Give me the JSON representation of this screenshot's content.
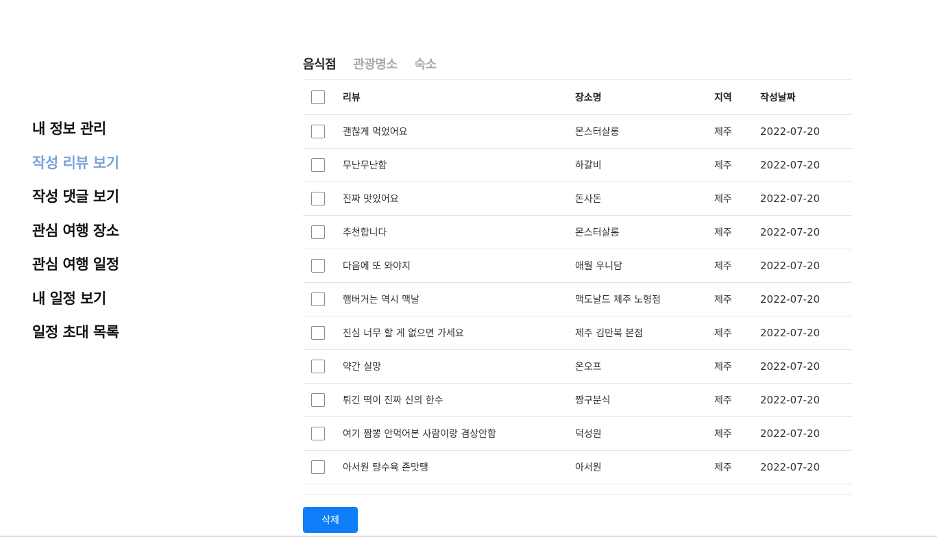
{
  "sidebar": {
    "items": [
      {
        "label": "내 정보 관리",
        "active": false
      },
      {
        "label": "작성 리뷰 보기",
        "active": true
      },
      {
        "label": "작성 댓글 보기",
        "active": false
      },
      {
        "label": "관심 여행 장소",
        "active": false
      },
      {
        "label": "관심 여행 일정",
        "active": false
      },
      {
        "label": "내 일정 보기",
        "active": false
      },
      {
        "label": "일정 초대 목록",
        "active": false
      }
    ]
  },
  "tabs": [
    {
      "label": "음식점",
      "active": true
    },
    {
      "label": "관광명소",
      "active": false
    },
    {
      "label": "숙소",
      "active": false
    }
  ],
  "table": {
    "headers": {
      "review": "리뷰",
      "place": "장소명",
      "region": "지역",
      "date": "작성날짜"
    },
    "rows": [
      {
        "review": "괜찮게 먹었어요",
        "place": "몬스터살롱",
        "region": "제주",
        "date": "2022-07-20"
      },
      {
        "review": "무난무난함",
        "place": "하갈비",
        "region": "제주",
        "date": "2022-07-20"
      },
      {
        "review": "진짜 맛있어요",
        "place": "돈사돈",
        "region": "제주",
        "date": "2022-07-20"
      },
      {
        "review": "추천합니다",
        "place": "몬스터살롱",
        "region": "제주",
        "date": "2022-07-20"
      },
      {
        "review": "다음에 또 와야지",
        "place": "애월 우니담",
        "region": "제주",
        "date": "2022-07-20"
      },
      {
        "review": "햄버거는 역시 맥날",
        "place": "맥도날드 제주 노형점",
        "region": "제주",
        "date": "2022-07-20"
      },
      {
        "review": "진심 너무 할 게 없으면 가세요",
        "place": "제주 김만복 본점",
        "region": "제주",
        "date": "2022-07-20"
      },
      {
        "review": "약간 실망",
        "place": "온오프",
        "region": "제주",
        "date": "2022-07-20"
      },
      {
        "review": "튀긴 떡이 진짜 신의 한수",
        "place": "짱구분식",
        "region": "제주",
        "date": "2022-07-20"
      },
      {
        "review": "여기 짬뽕 안먹어본 사람이랑 겸상안함",
        "place": "덕성원",
        "region": "제주",
        "date": "2022-07-20"
      },
      {
        "review": "아서원 탕수육 존맛탱",
        "place": "아서원",
        "region": "제주",
        "date": "2022-07-20"
      }
    ]
  },
  "actions": {
    "delete_label": "삭제"
  },
  "colors": {
    "accent": "#0d7ef7",
    "active_sidebar": "#7ba3d8",
    "inactive_tab": "#a9a9a9"
  }
}
